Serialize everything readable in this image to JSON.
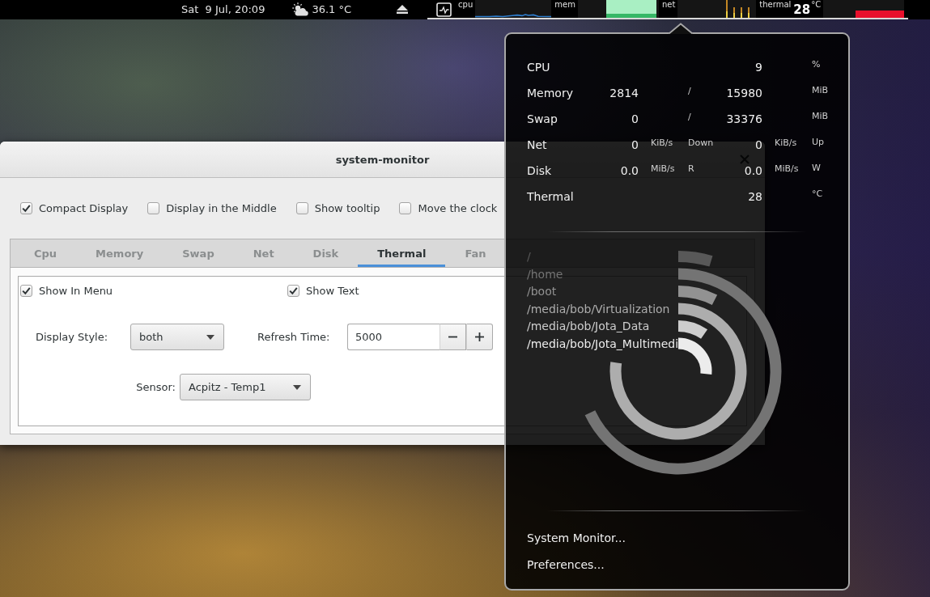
{
  "top_bar": {
    "clock": "Sat  9 Jul, 20:09",
    "temperature": "36.1 °C",
    "graphs": [
      {
        "kind": "cpu",
        "label": "cpu"
      },
      {
        "kind": "memory",
        "label": "mem"
      },
      {
        "kind": "network",
        "label": "net"
      },
      {
        "kind": "thermal",
        "label": "thermal",
        "reading": "28",
        "unit": "°C"
      }
    ]
  },
  "dialog": {
    "title": "system-monitor",
    "options": [
      {
        "label": "Compact Display",
        "checked": true
      },
      {
        "label": "Display in the Middle",
        "checked": false
      },
      {
        "label": "Show tooltip",
        "checked": false
      },
      {
        "label": "Move the clock",
        "checked": false
      }
    ],
    "tabs": [
      {
        "label": "Cpu",
        "selected": false
      },
      {
        "label": "Memory",
        "selected": false
      },
      {
        "label": "Swap",
        "selected": false
      },
      {
        "label": "Net",
        "selected": false
      },
      {
        "label": "Disk",
        "selected": false
      },
      {
        "label": "Thermal",
        "selected": true
      },
      {
        "label": "Fan",
        "selected": false
      }
    ],
    "page": {
      "show_in_menu": {
        "label": "Show In Menu",
        "checked": true
      },
      "show_text": {
        "label": "Show Text",
        "checked": true
      },
      "display_style": {
        "label": "Display Style:",
        "value": "both"
      },
      "refresh_time": {
        "label": "Refresh Time:",
        "value": "5000"
      },
      "sensor": {
        "label": "Sensor:",
        "value": "Acpitz - Temp1"
      }
    }
  },
  "menu": {
    "stats": [
      {
        "label": "CPU",
        "second": "9",
        "end_unit": "%"
      },
      {
        "label": "Memory",
        "first": "2814",
        "middle": "/",
        "second": "15980",
        "end_unit": "MiB"
      },
      {
        "label": "Swap",
        "first": "0",
        "middle": "/",
        "second": "33376",
        "end_unit": "MiB"
      },
      {
        "label": "Net",
        "first": "0",
        "first_unit": "KiB/s",
        "middle": "Down",
        "second": "0",
        "second_unit": "KiB/s",
        "end_unit": "Up"
      },
      {
        "label": "Disk",
        "first": "0.0",
        "first_unit": "MiB/s",
        "middle": "R",
        "second": "0.0",
        "second_unit": "MiB/s",
        "end_unit": "W"
      },
      {
        "label": "Thermal",
        "second": "28",
        "end_unit": "°C"
      }
    ],
    "disks": [
      {
        "path": "/",
        "color": "#585858"
      },
      {
        "path": "/home",
        "color": "#747474"
      },
      {
        "path": "/boot",
        "color": "#929292"
      },
      {
        "path": "/media/bob/Virtualization",
        "color": "#adadad"
      },
      {
        "path": "/media/bob/Jota_Data",
        "color": "#cdcdcd"
      },
      {
        "path": "/media/bob/Jota_Multimedi",
        "color": "#ececec"
      }
    ],
    "items": [
      {
        "label": "System Monitor..."
      },
      {
        "label": "Preferences..."
      }
    ]
  }
}
